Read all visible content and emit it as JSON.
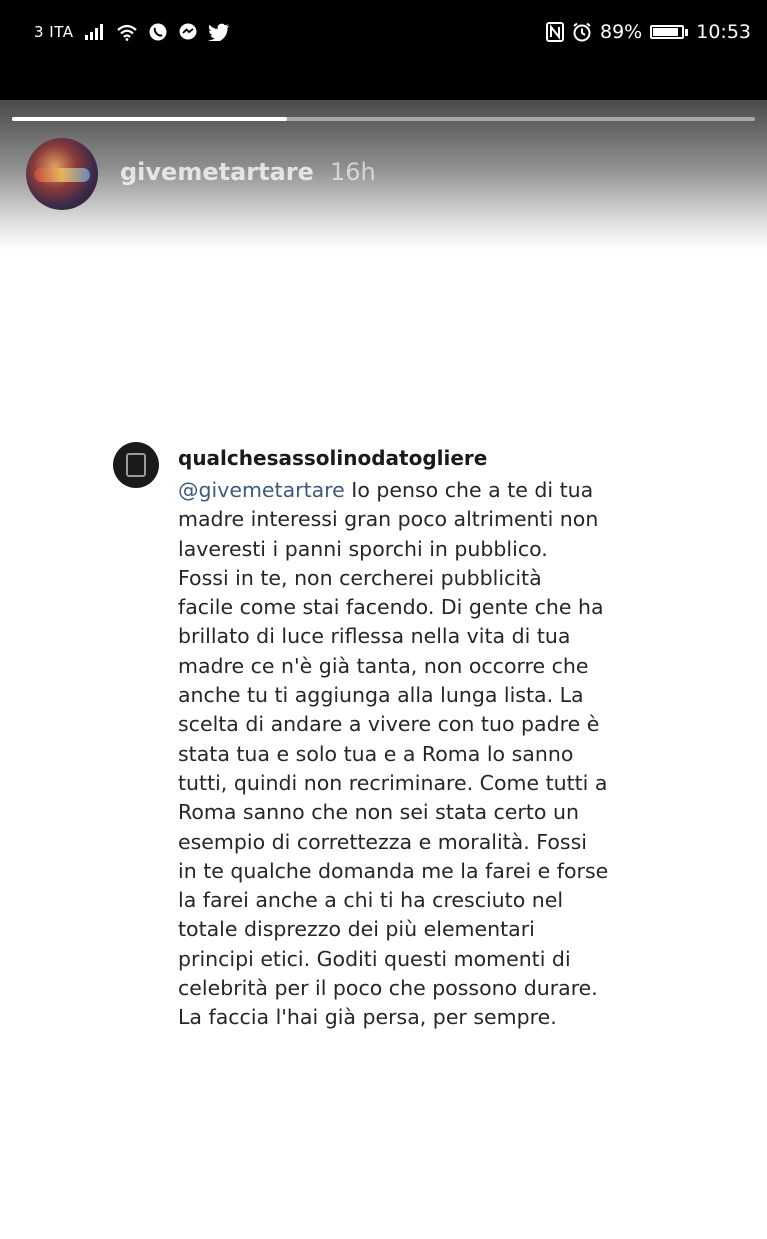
{
  "status_bar": {
    "carrier": "3 ITA",
    "battery_percent": "89%",
    "battery_level": 0.89,
    "time": "10:53",
    "icons": [
      "signal-icon",
      "wifi-icon",
      "whatsapp-icon",
      "messenger-icon",
      "twitter-icon",
      "nfc-icon",
      "alarm-icon",
      "battery-icon"
    ]
  },
  "story": {
    "progress": 0.37,
    "username": "givemetartare",
    "time_ago": "16h"
  },
  "comment": {
    "username": "qualchesassolinodatogliere",
    "mention": "@givemetartare",
    "lines": [
      " Io penso che a te di tua",
      "madre interessi gran poco altrimenti non",
      "laveresti i panni sporchi in pubblico.",
      "Fossi in te, non cercherei pubblicità",
      "facile come stai facendo. Di gente che ha",
      "brillato di luce riflessa nella vita di tua",
      "madre ce n'è già tanta, non occorre che",
      "anche tu ti aggiunga alla lunga lista. La",
      "scelta di andare a vivere con tuo padre è",
      "stata tua e solo tua e a Roma lo sanno",
      "tutti, quindi non recriminare. Come tutti a",
      "Roma sanno che non sei stata certo un",
      "esempio di correttezza e moralità. Fossi",
      "in te qualche domanda me la farei e forse",
      "la farei anche a chi ti ha cresciuto nel",
      "totale disprezzo dei più elementari",
      "principi etici. Goditi questi momenti di",
      "celebrità per il poco che possono durare.",
      "La faccia l'hai già persa, per sempre."
    ]
  }
}
